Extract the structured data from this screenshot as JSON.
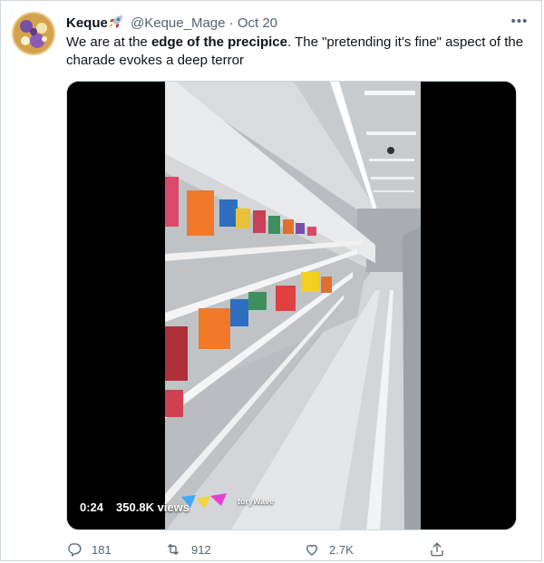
{
  "tweet": {
    "author_name": "Keque",
    "handle": "@Keque_Mage",
    "separator": "·",
    "date": "Oct 20",
    "more_label": "•••",
    "text_before": "We are at the ",
    "text_bold": "edge of the precipice",
    "text_after": ". The \"pretending it's fine\" aspect of the charade evokes a deep terror"
  },
  "video": {
    "time": "0:24",
    "views": "350.8K views",
    "watermark": "toryWave"
  },
  "actions": {
    "replies": "181",
    "retweets": "912",
    "likes": "2.7K"
  },
  "colors": {
    "text_primary": "#0f1419",
    "text_secondary": "#536471",
    "border": "#cfd9de"
  },
  "icons": [
    "rocket-icon",
    "more-icon",
    "reply-icon",
    "retweet-icon",
    "like-icon",
    "share-icon"
  ]
}
